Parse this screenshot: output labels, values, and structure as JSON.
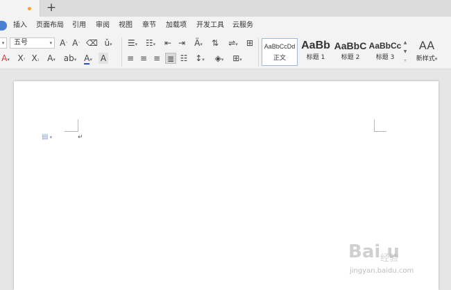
{
  "tabs": {
    "add_label": "+"
  },
  "menubar": {
    "items": [
      "插入",
      "页面布局",
      "引用",
      "审阅",
      "视图",
      "章节",
      "加载项",
      "开发工具",
      "云服务"
    ]
  },
  "ribbon": {
    "font_size": "五号",
    "style_gallery": [
      {
        "sample": "AaBbCcDd",
        "label": "正文"
      },
      {
        "sample": "AaBb",
        "label": "标题 1"
      },
      {
        "sample": "AaBbC",
        "label": "标题 2"
      },
      {
        "sample": "AaBbCc",
        "label": "标题 3"
      }
    ],
    "new_style_label": "新样式",
    "new_style_glyph": "AA"
  },
  "document": {
    "paragraph_mark": "↵"
  },
  "watermark": {
    "logo": "Bai  u",
    "jingyan": "经验",
    "url": "jingyan.baidu.com"
  },
  "colors": {
    "tab_dot": "#f0a33c",
    "start_button": "#4a7fd6",
    "font_color_underline": "#1f4fd6",
    "highlight": "#f7c948",
    "style_active_border": "#9db8dc"
  }
}
